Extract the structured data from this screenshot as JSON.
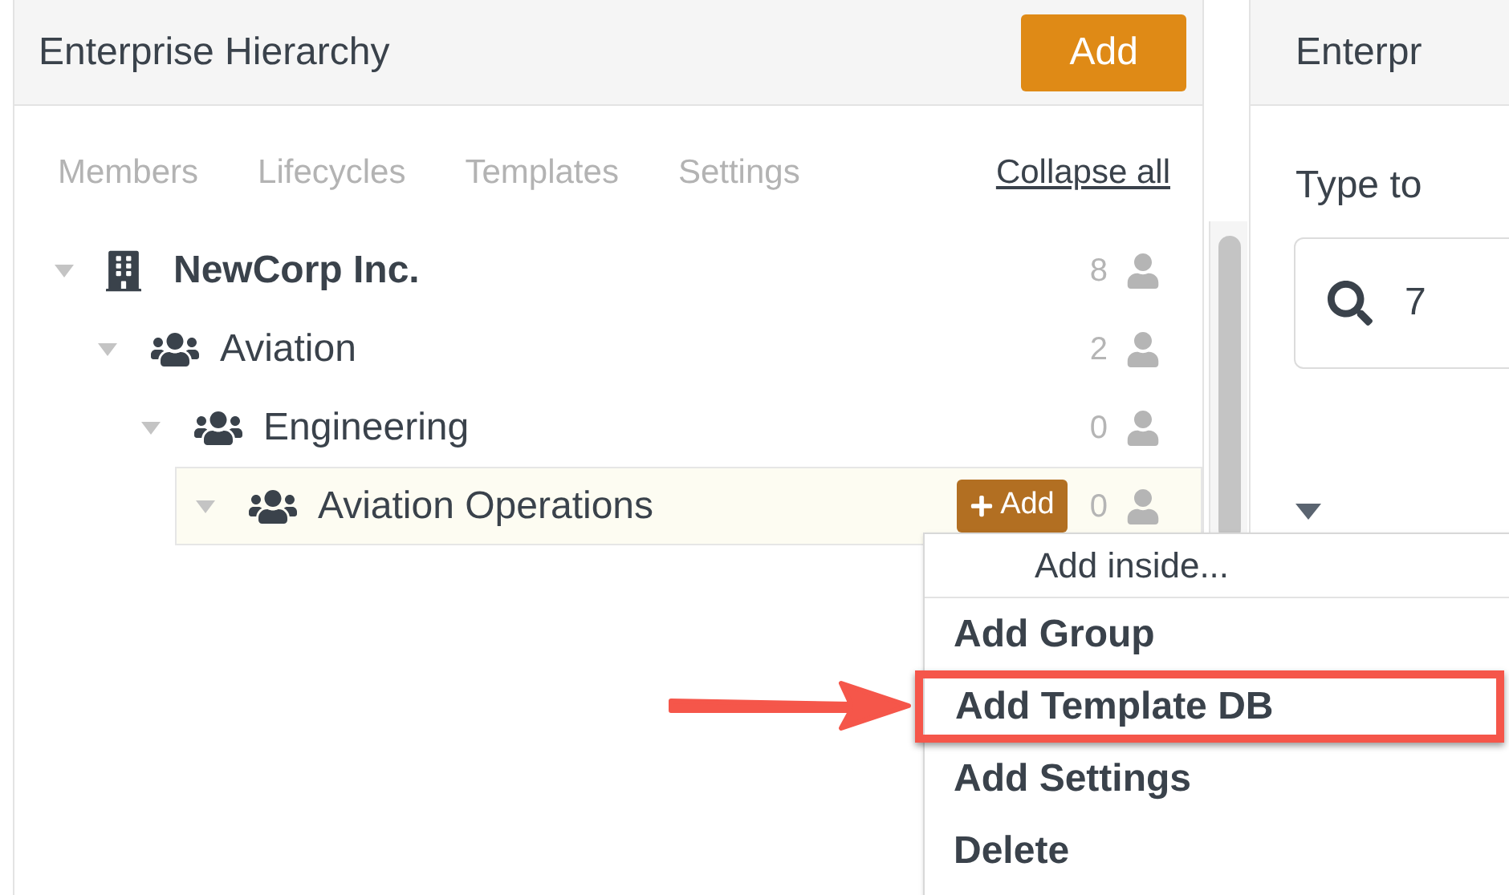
{
  "left_panel": {
    "title": "Enterprise Hierarchy",
    "add_button": "Add",
    "tabs": [
      "Members",
      "Lifecycles",
      "Templates",
      "Settings"
    ],
    "collapse_link": "Collapse all",
    "tree": [
      {
        "kind": "company",
        "label": "NewCorp Inc.",
        "count": "8",
        "selected": false,
        "children": [
          {
            "kind": "group",
            "label": "Aviation",
            "count": "2",
            "selected": false,
            "children": [
              {
                "kind": "group",
                "label": "Engineering",
                "count": "0",
                "selected": false,
                "children": [
                  {
                    "kind": "group",
                    "label": "Aviation Operations",
                    "count": "0",
                    "selected": true,
                    "add_label": "Add"
                  }
                ]
              }
            ]
          }
        ]
      }
    ]
  },
  "menu": {
    "header": "Add inside...",
    "items": [
      {
        "label": "Add Group",
        "highlighted": false
      },
      {
        "label": "Add Template DB",
        "highlighted": true
      },
      {
        "label": "Add Settings",
        "highlighted": false
      },
      {
        "label": "Delete",
        "highlighted": false
      }
    ]
  },
  "right_panel": {
    "title": "Enterpr",
    "prompt": "Type to",
    "search_value": "7"
  }
}
